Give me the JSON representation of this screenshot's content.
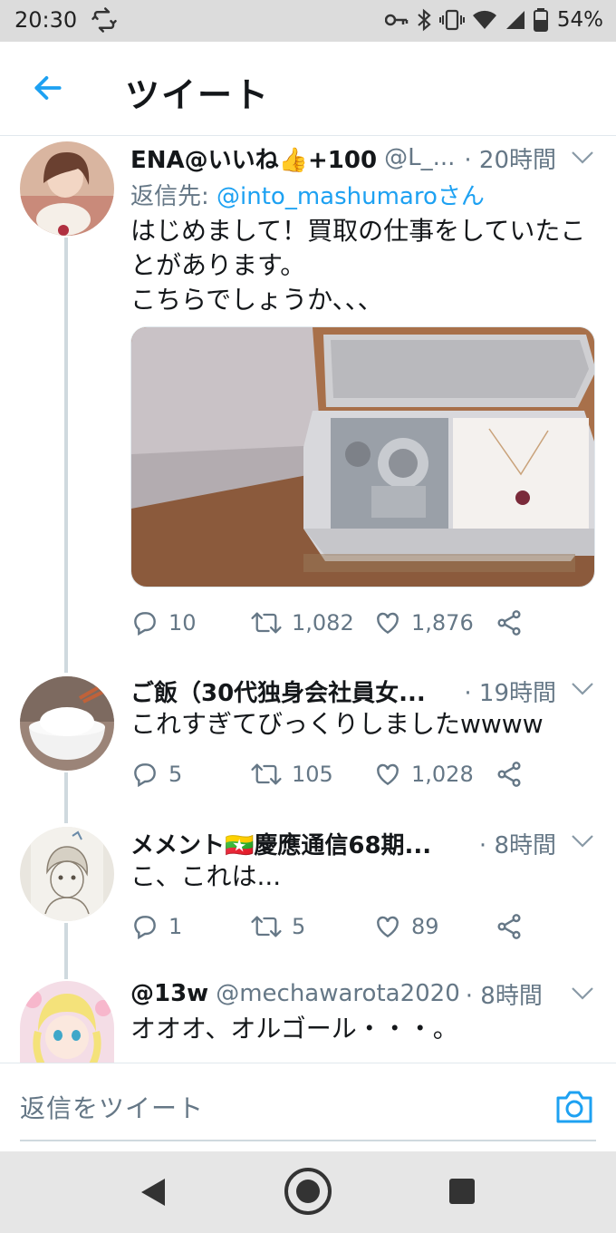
{
  "status_bar": {
    "time": "20:30",
    "battery": "54%",
    "icons": [
      "retweet-notification-icon",
      "key-icon",
      "bluetooth-icon",
      "vibrate-icon",
      "wifi-icon",
      "signal-icon",
      "battery-icon"
    ]
  },
  "header": {
    "title": "ツイート",
    "back_icon": "arrow-left-icon"
  },
  "tweets": [
    {
      "name": "ENA@いいね👍+100",
      "handle": "@L_...",
      "time": "· 20時間",
      "reply_to_label": "返信先: ",
      "reply_to_mention": "@into_mashumaroさん",
      "text_lines": [
        "はじめまして！買取の仕事をしていたこ",
        "とがあります。",
        "こちらでしょうか、、、"
      ],
      "has_media": true,
      "replies": "10",
      "retweets": "1,082",
      "likes": "1,876"
    },
    {
      "name": "ご飯（30代独身会社員女...",
      "handle": "",
      "time": "· 19時間",
      "text_lines": [
        "これすぎてびっくりしましたwwww"
      ],
      "replies": "5",
      "retweets": "105",
      "likes": "1,028"
    },
    {
      "name": "メメント🇲🇲慶應通信68期...",
      "handle": "",
      "time": "· 8時間",
      "text_lines": [
        "こ、これは..."
      ],
      "replies": "1",
      "retweets": "5",
      "likes": "89"
    },
    {
      "name": "@13w",
      "handle": "@mechawarota2020",
      "time": "· 8時間",
      "text_lines": [
        "オオオ、オルゴール・・・。"
      ]
    }
  ],
  "reply_bar": {
    "placeholder": "返信をツイート",
    "camera_icon": "camera-icon"
  },
  "colors": {
    "accent": "#1da1f2",
    "text_secondary": "#657786",
    "thread_line": "#cfd9de"
  }
}
